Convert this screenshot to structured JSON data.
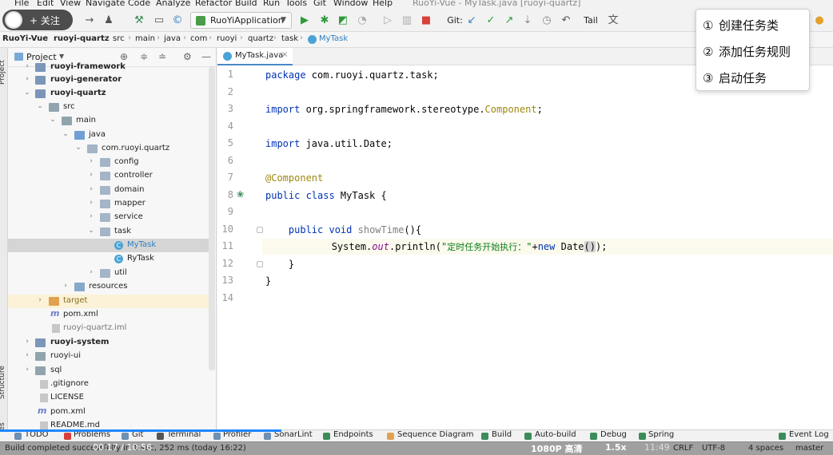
{
  "menu": {
    "items": [
      "File",
      "Edit",
      "View",
      "Navigate",
      "Code",
      "Analyze",
      "Refactor",
      "Build",
      "Run",
      "Tools",
      "Git",
      "Window",
      "Help"
    ],
    "window_title": "RuoYi-Vue - MyTask.java [ruoyi-quartz]"
  },
  "streamer": {
    "follow_label": "+ 关注"
  },
  "toolbar": {
    "run_config": "RuoYiApplication",
    "git_label": "Git:",
    "tail_label": "Tail"
  },
  "breadcrumb": [
    "RuoYi-Vue",
    "ruoyi-quartz",
    "src",
    "main",
    "java",
    "com",
    "ruoyi",
    "quartz",
    "task",
    "MyTask"
  ],
  "left_strip": {
    "project": "Project",
    "structure": "Structure",
    "favorites": "Favorites"
  },
  "project_panel": {
    "title": "Project"
  },
  "tree": [
    {
      "label": "ruoyi-framework",
      "bold": true
    },
    {
      "label": "ruoyi-generator",
      "bold": true
    },
    {
      "label": "ruoyi-quartz",
      "bold": true
    },
    {
      "label": "src"
    },
    {
      "label": "main"
    },
    {
      "label": "java"
    },
    {
      "label": "com.ruoyi.quartz"
    },
    {
      "label": "config"
    },
    {
      "label": "controller"
    },
    {
      "label": "domain"
    },
    {
      "label": "mapper"
    },
    {
      "label": "service"
    },
    {
      "label": "task"
    },
    {
      "label": "MyTask"
    },
    {
      "label": "RyTask"
    },
    {
      "label": "util"
    },
    {
      "label": "resources"
    },
    {
      "label": "target"
    },
    {
      "label": "pom.xml"
    },
    {
      "label": "ruoyi-quartz.iml"
    },
    {
      "label": "ruoyi-system",
      "bold": true
    },
    {
      "label": "ruoyi-ui"
    },
    {
      "label": "sql"
    },
    {
      "label": ".gitignore"
    },
    {
      "label": "LICENSE"
    },
    {
      "label": "pom.xml"
    },
    {
      "label": "README.md"
    }
  ],
  "editor": {
    "tab_label": "MyTask.java",
    "line_numbers": [
      "1",
      "2",
      "3",
      "4",
      "5",
      "6",
      "7",
      "8",
      "9",
      "10",
      "11",
      "12",
      "13",
      "14"
    ],
    "code": {
      "l1_kw": "package",
      "l1_rest": " com.ruoyi.quartz.task;",
      "l3_kw": "import",
      "l3_rest": " org.springframework.stereotype.",
      "l3_cls": "Component",
      "l3_end": ";",
      "l5_kw": "import",
      "l5_rest": " java.util.Date;",
      "l7_an": "@Component",
      "l8_kw": "public class",
      "l8_rest": " MyTask {",
      "l10_kw": "public void",
      "l10_mt": " showTime",
      "l10_rest": "(){",
      "l11_a": "System.",
      "l11_it": "out",
      "l11_b": ".println(",
      "l11_q1": "\"",
      "l11_str": "定时任务开始执行：",
      "l11_q2": "\"",
      "l11_c": "+",
      "l11_new": "new",
      "l11_d": " Date",
      "l11_par": "()",
      "l11_e": ");",
      "l12": "}",
      "l13": "}"
    }
  },
  "popup": {
    "items": [
      {
        "num": "①",
        "label": "创建任务类"
      },
      {
        "num": "②",
        "label": "添加任务规则"
      },
      {
        "num": "③",
        "label": "启动任务"
      }
    ]
  },
  "bottom_tools": [
    "TODO",
    "Problems",
    "Git",
    "Terminal",
    "Profiler",
    "SonarLint",
    "Endpoints",
    "Sequence Diagram",
    "Build",
    "Auto-build",
    "Debug",
    "Spring",
    "Event Log"
  ],
  "status": {
    "message": "Build completed successfully in 1 sec, 252 ms (today 16:22)",
    "video_time": "00:17 / 10:56",
    "quality": "1080P 高清",
    "speed": "1.5x",
    "position": "11:49",
    "line_sep": "CRLF",
    "encoding": "UTF-8",
    "spaces": "4 spaces",
    "branch": "master"
  },
  "colors": {
    "accent": "#4a88c7",
    "progress": "#1f86ff",
    "keyword": "#0033b3",
    "string": "#067d17",
    "annotation": "#9e880d"
  }
}
